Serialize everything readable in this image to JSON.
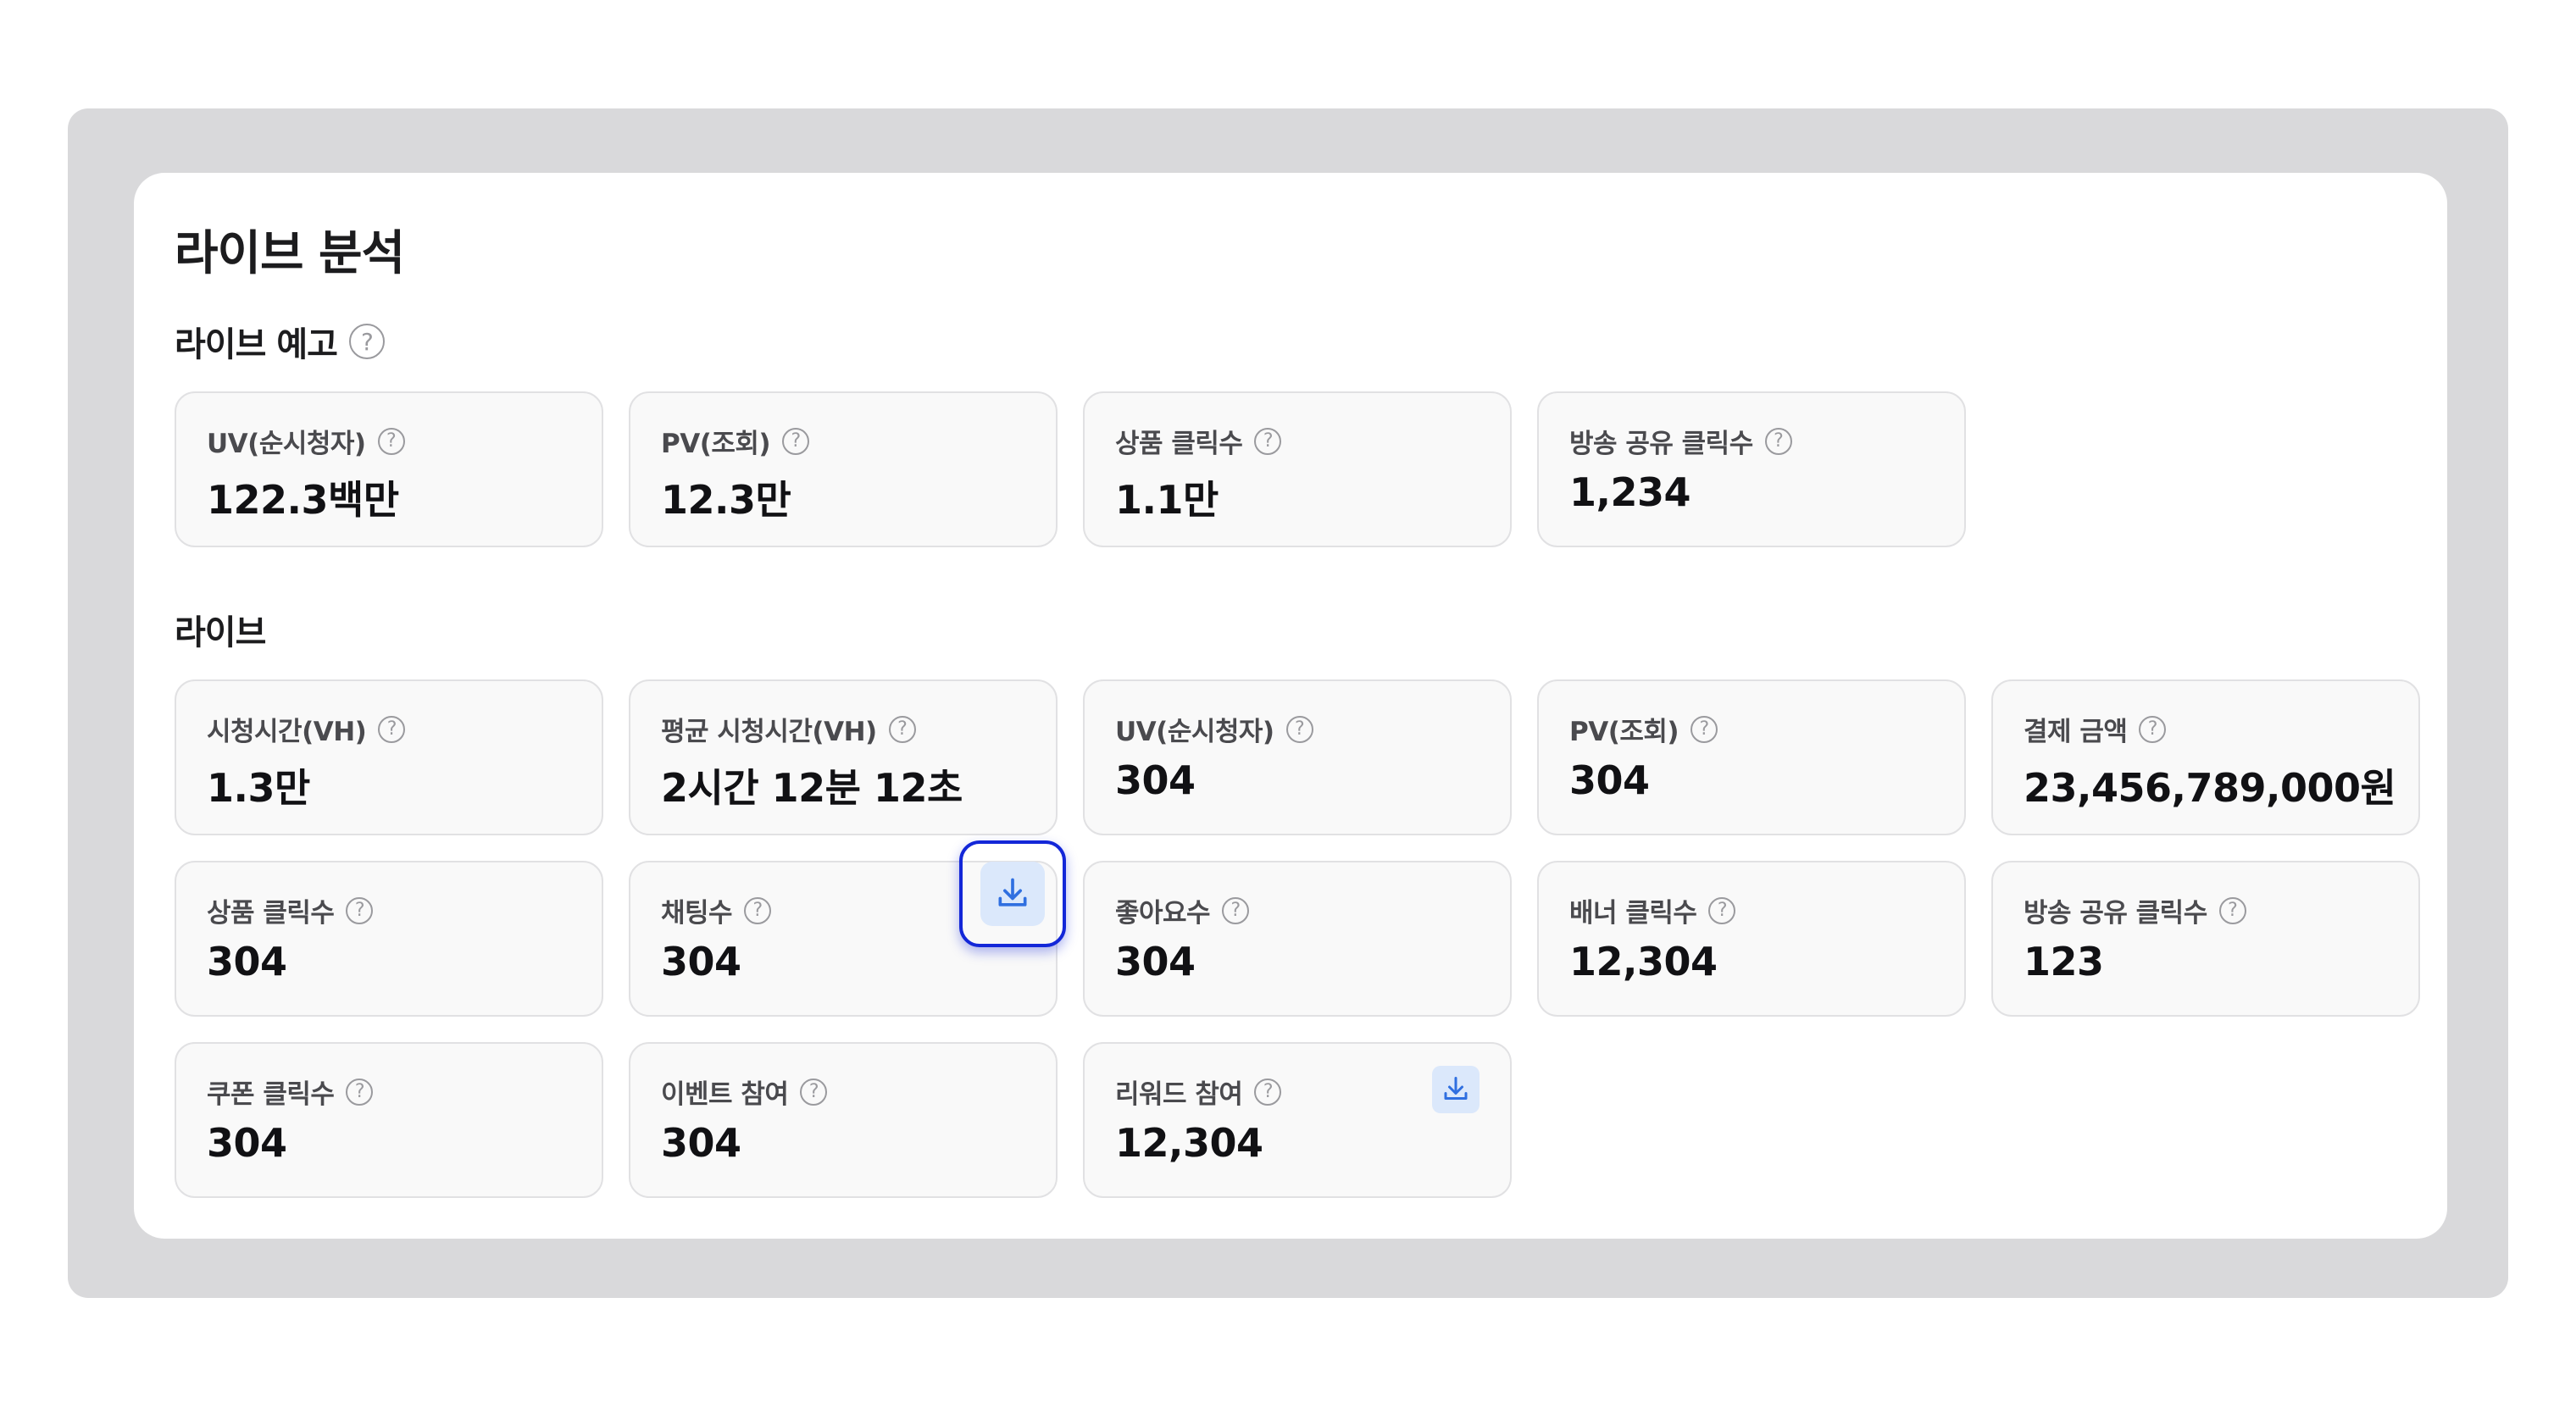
{
  "page": {
    "title": "라이브 분석",
    "help_glyph": "?"
  },
  "preview": {
    "title": "라이브 예고",
    "cards": [
      {
        "label": "UV(순시청자)",
        "value": "122.3백만"
      },
      {
        "label": "PV(조회)",
        "value": "12.3만"
      },
      {
        "label": "상품 클릭수",
        "value": "1.1만"
      },
      {
        "label": "방송 공유 클릭수",
        "value": "1,234"
      }
    ]
  },
  "live": {
    "title": "라이브",
    "cards": [
      {
        "label": "시청시간(VH)",
        "value": "1.3만"
      },
      {
        "label": "평균 시청시간(VH)",
        "value": "2시간 12분 12초"
      },
      {
        "label": "UV(순시청자)",
        "value": "304"
      },
      {
        "label": "PV(조회)",
        "value": "304"
      },
      {
        "label": "결제 금액",
        "value": "23,456,789,000원"
      },
      {
        "label": "상품 클릭수",
        "value": "304"
      },
      {
        "label": "채팅수",
        "value": "304"
      },
      {
        "label": "좋아요수",
        "value": "304"
      },
      {
        "label": "배너 클릭수",
        "value": "12,304"
      },
      {
        "label": "방송 공유 클릭수",
        "value": "123"
      },
      {
        "label": "쿠폰 클릭수",
        "value": "304"
      },
      {
        "label": "이벤트 참여",
        "value": "304"
      },
      {
        "label": "리워드 참여",
        "value": "12,304"
      }
    ]
  },
  "icons": {
    "help": "question-circle-icon",
    "download": "download-icon"
  },
  "colors": {
    "download_bg": "#dbe8fb",
    "download_icon": "#2f6fe0",
    "focus_ring": "#1327d8"
  }
}
